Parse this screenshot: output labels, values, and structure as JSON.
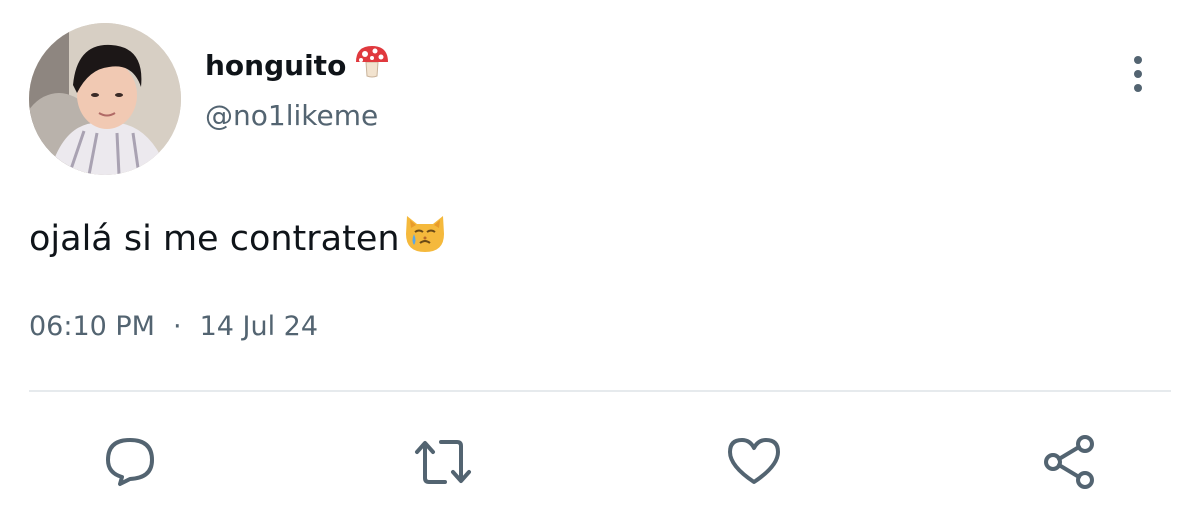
{
  "user": {
    "display_name": "honguito",
    "name_emoji": "mushroom-emoji",
    "handle": "@no1likeme"
  },
  "tweet": {
    "text": "ojalá si me contraten",
    "trailing_emoji": "crying-cat-emoji"
  },
  "meta": {
    "time": "06:10 PM",
    "separator": "·",
    "date": "14 Jul 24"
  },
  "actions": [
    "reply-icon",
    "retweet-icon",
    "like-icon",
    "share-icon"
  ],
  "colors": {
    "text": "#0f1419",
    "secondary": "#536471",
    "divider": "#e6eaed",
    "background": "#ffffff"
  }
}
